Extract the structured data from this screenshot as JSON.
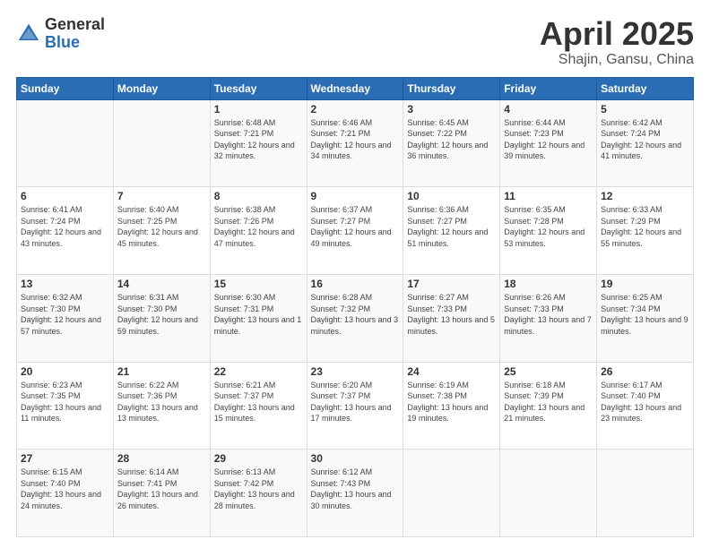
{
  "header": {
    "logo_general": "General",
    "logo_blue": "Blue",
    "month": "April 2025",
    "location": "Shajin, Gansu, China"
  },
  "days_of_week": [
    "Sunday",
    "Monday",
    "Tuesday",
    "Wednesday",
    "Thursday",
    "Friday",
    "Saturday"
  ],
  "weeks": [
    [
      {
        "day": "",
        "sunrise": "",
        "sunset": "",
        "daylight": ""
      },
      {
        "day": "",
        "sunrise": "",
        "sunset": "",
        "daylight": ""
      },
      {
        "day": "1",
        "sunrise": "Sunrise: 6:48 AM",
        "sunset": "Sunset: 7:21 PM",
        "daylight": "Daylight: 12 hours and 32 minutes."
      },
      {
        "day": "2",
        "sunrise": "Sunrise: 6:46 AM",
        "sunset": "Sunset: 7:21 PM",
        "daylight": "Daylight: 12 hours and 34 minutes."
      },
      {
        "day": "3",
        "sunrise": "Sunrise: 6:45 AM",
        "sunset": "Sunset: 7:22 PM",
        "daylight": "Daylight: 12 hours and 36 minutes."
      },
      {
        "day": "4",
        "sunrise": "Sunrise: 6:44 AM",
        "sunset": "Sunset: 7:23 PM",
        "daylight": "Daylight: 12 hours and 39 minutes."
      },
      {
        "day": "5",
        "sunrise": "Sunrise: 6:42 AM",
        "sunset": "Sunset: 7:24 PM",
        "daylight": "Daylight: 12 hours and 41 minutes."
      }
    ],
    [
      {
        "day": "6",
        "sunrise": "Sunrise: 6:41 AM",
        "sunset": "Sunset: 7:24 PM",
        "daylight": "Daylight: 12 hours and 43 minutes."
      },
      {
        "day": "7",
        "sunrise": "Sunrise: 6:40 AM",
        "sunset": "Sunset: 7:25 PM",
        "daylight": "Daylight: 12 hours and 45 minutes."
      },
      {
        "day": "8",
        "sunrise": "Sunrise: 6:38 AM",
        "sunset": "Sunset: 7:26 PM",
        "daylight": "Daylight: 12 hours and 47 minutes."
      },
      {
        "day": "9",
        "sunrise": "Sunrise: 6:37 AM",
        "sunset": "Sunset: 7:27 PM",
        "daylight": "Daylight: 12 hours and 49 minutes."
      },
      {
        "day": "10",
        "sunrise": "Sunrise: 6:36 AM",
        "sunset": "Sunset: 7:27 PM",
        "daylight": "Daylight: 12 hours and 51 minutes."
      },
      {
        "day": "11",
        "sunrise": "Sunrise: 6:35 AM",
        "sunset": "Sunset: 7:28 PM",
        "daylight": "Daylight: 12 hours and 53 minutes."
      },
      {
        "day": "12",
        "sunrise": "Sunrise: 6:33 AM",
        "sunset": "Sunset: 7:29 PM",
        "daylight": "Daylight: 12 hours and 55 minutes."
      }
    ],
    [
      {
        "day": "13",
        "sunrise": "Sunrise: 6:32 AM",
        "sunset": "Sunset: 7:30 PM",
        "daylight": "Daylight: 12 hours and 57 minutes."
      },
      {
        "day": "14",
        "sunrise": "Sunrise: 6:31 AM",
        "sunset": "Sunset: 7:30 PM",
        "daylight": "Daylight: 12 hours and 59 minutes."
      },
      {
        "day": "15",
        "sunrise": "Sunrise: 6:30 AM",
        "sunset": "Sunset: 7:31 PM",
        "daylight": "Daylight: 13 hours and 1 minute."
      },
      {
        "day": "16",
        "sunrise": "Sunrise: 6:28 AM",
        "sunset": "Sunset: 7:32 PM",
        "daylight": "Daylight: 13 hours and 3 minutes."
      },
      {
        "day": "17",
        "sunrise": "Sunrise: 6:27 AM",
        "sunset": "Sunset: 7:33 PM",
        "daylight": "Daylight: 13 hours and 5 minutes."
      },
      {
        "day": "18",
        "sunrise": "Sunrise: 6:26 AM",
        "sunset": "Sunset: 7:33 PM",
        "daylight": "Daylight: 13 hours and 7 minutes."
      },
      {
        "day": "19",
        "sunrise": "Sunrise: 6:25 AM",
        "sunset": "Sunset: 7:34 PM",
        "daylight": "Daylight: 13 hours and 9 minutes."
      }
    ],
    [
      {
        "day": "20",
        "sunrise": "Sunrise: 6:23 AM",
        "sunset": "Sunset: 7:35 PM",
        "daylight": "Daylight: 13 hours and 11 minutes."
      },
      {
        "day": "21",
        "sunrise": "Sunrise: 6:22 AM",
        "sunset": "Sunset: 7:36 PM",
        "daylight": "Daylight: 13 hours and 13 minutes."
      },
      {
        "day": "22",
        "sunrise": "Sunrise: 6:21 AM",
        "sunset": "Sunset: 7:37 PM",
        "daylight": "Daylight: 13 hours and 15 minutes."
      },
      {
        "day": "23",
        "sunrise": "Sunrise: 6:20 AM",
        "sunset": "Sunset: 7:37 PM",
        "daylight": "Daylight: 13 hours and 17 minutes."
      },
      {
        "day": "24",
        "sunrise": "Sunrise: 6:19 AM",
        "sunset": "Sunset: 7:38 PM",
        "daylight": "Daylight: 13 hours and 19 minutes."
      },
      {
        "day": "25",
        "sunrise": "Sunrise: 6:18 AM",
        "sunset": "Sunset: 7:39 PM",
        "daylight": "Daylight: 13 hours and 21 minutes."
      },
      {
        "day": "26",
        "sunrise": "Sunrise: 6:17 AM",
        "sunset": "Sunset: 7:40 PM",
        "daylight": "Daylight: 13 hours and 23 minutes."
      }
    ],
    [
      {
        "day": "27",
        "sunrise": "Sunrise: 6:15 AM",
        "sunset": "Sunset: 7:40 PM",
        "daylight": "Daylight: 13 hours and 24 minutes."
      },
      {
        "day": "28",
        "sunrise": "Sunrise: 6:14 AM",
        "sunset": "Sunset: 7:41 PM",
        "daylight": "Daylight: 13 hours and 26 minutes."
      },
      {
        "day": "29",
        "sunrise": "Sunrise: 6:13 AM",
        "sunset": "Sunset: 7:42 PM",
        "daylight": "Daylight: 13 hours and 28 minutes."
      },
      {
        "day": "30",
        "sunrise": "Sunrise: 6:12 AM",
        "sunset": "Sunset: 7:43 PM",
        "daylight": "Daylight: 13 hours and 30 minutes."
      },
      {
        "day": "",
        "sunrise": "",
        "sunset": "",
        "daylight": ""
      },
      {
        "day": "",
        "sunrise": "",
        "sunset": "",
        "daylight": ""
      },
      {
        "day": "",
        "sunrise": "",
        "sunset": "",
        "daylight": ""
      }
    ]
  ]
}
